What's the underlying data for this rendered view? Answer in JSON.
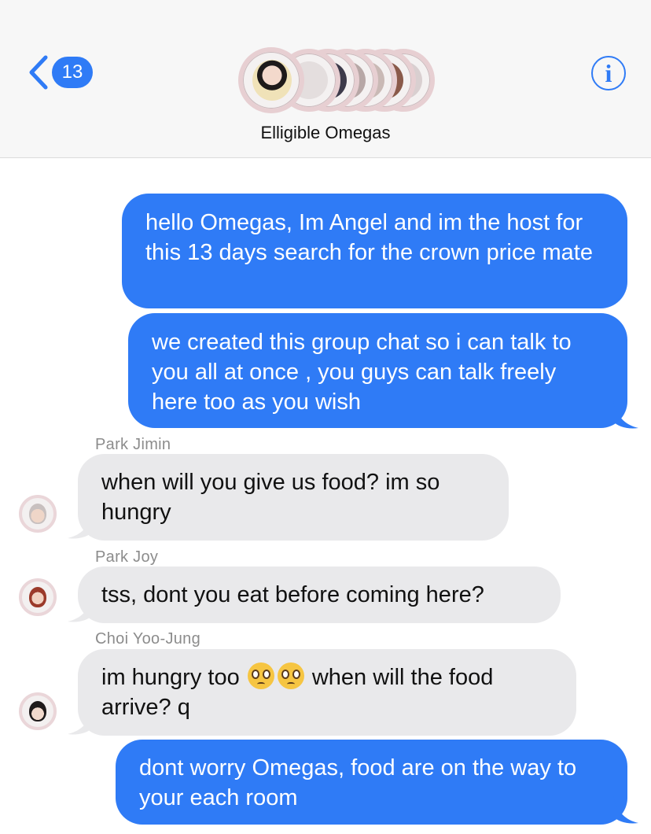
{
  "header": {
    "back_count": "13",
    "group_name": "Elligible Omegas",
    "info_glyph": "i",
    "avatar_count": 6,
    "accent_color": "#2f7bf6"
  },
  "messages": [
    {
      "direction": "outgoing",
      "text": "hello Omegas, Im Angel and im the host for this 13 days search for the crown price mate"
    },
    {
      "direction": "outgoing",
      "text": "we created this group chat so i can talk to you all at once , you guys can talk freely here too as you wish"
    },
    {
      "direction": "incoming",
      "sender": "Park Jimin",
      "text": "when will you give us food? im so hungry"
    },
    {
      "direction": "incoming",
      "sender": "Park Joy",
      "text": "tss, dont you eat before coming here?"
    },
    {
      "direction": "incoming",
      "sender": "Choi Yoo-Jung",
      "text_before": "im hungry too",
      "emoji": "pleading-face",
      "text_after": "when will the food arrive? q"
    },
    {
      "direction": "outgoing",
      "text": "dont worry Omegas, food are on the way to your each room"
    }
  ]
}
